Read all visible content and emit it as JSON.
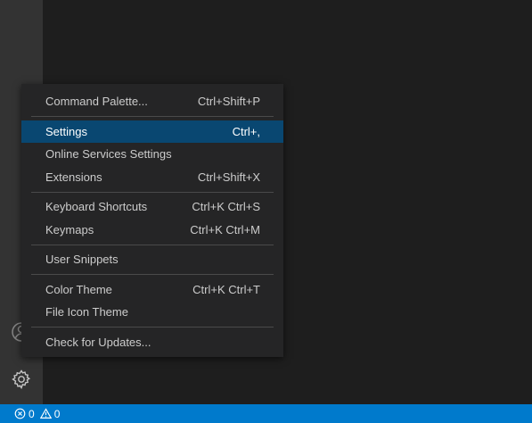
{
  "menu": {
    "items": [
      {
        "label": "Command Palette...",
        "shortcut": "Ctrl+Shift+P"
      },
      {
        "label": "Settings",
        "shortcut": "Ctrl+,"
      },
      {
        "label": "Online Services Settings",
        "shortcut": ""
      },
      {
        "label": "Extensions",
        "shortcut": "Ctrl+Shift+X"
      },
      {
        "label": "Keyboard Shortcuts",
        "shortcut": "Ctrl+K Ctrl+S"
      },
      {
        "label": "Keymaps",
        "shortcut": "Ctrl+K Ctrl+M"
      },
      {
        "label": "User Snippets",
        "shortcut": ""
      },
      {
        "label": "Color Theme",
        "shortcut": "Ctrl+K Ctrl+T"
      },
      {
        "label": "File Icon Theme",
        "shortcut": ""
      },
      {
        "label": "Check for Updates...",
        "shortcut": ""
      }
    ],
    "active_item": "Settings"
  },
  "activity_bar": {
    "icons": [
      "account-icon",
      "gear-icon"
    ]
  },
  "status_bar": {
    "errors": "0",
    "warnings": "0"
  },
  "colors": {
    "status_bar": "#007acc",
    "menu_highlight": "#094771",
    "activity_bar": "#333333",
    "editor": "#1e1e1e",
    "menu_background": "#252526"
  }
}
